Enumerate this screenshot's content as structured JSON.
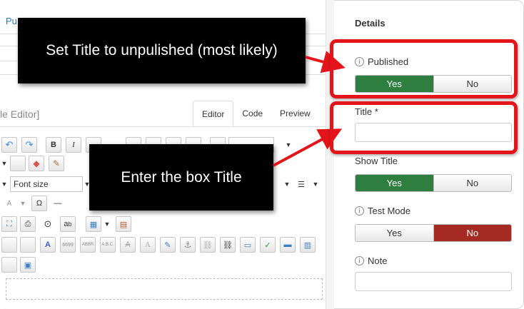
{
  "left": {
    "published_tab": "Pu",
    "editor_label": "le Editor]",
    "tabs": [
      {
        "label": "Editor",
        "active": true
      },
      {
        "label": "Code",
        "active": false
      },
      {
        "label": "Preview",
        "active": false
      }
    ],
    "toolbar": {
      "bold": "B",
      "italic": "I",
      "font_size": "Font size",
      "omega": "Ω",
      "abbr_a": "a",
      "abbr_b": "b",
      "quote": "6699",
      "abbr": "ABBR",
      "acronym": "A.B.C.",
      "strike_a": "A",
      "a_big": "A",
      "aa_small": "A"
    }
  },
  "annotations": {
    "callout_published": "Set Title to unpulished (most likely)",
    "callout_title": "Enter the box Title"
  },
  "details": {
    "heading": "Details",
    "published": {
      "label": "Published",
      "yes": "Yes",
      "no": "No",
      "selected": "yes"
    },
    "title": {
      "label": "Title *",
      "value": ""
    },
    "show_title": {
      "label": "Show Title",
      "yes": "Yes",
      "no": "No",
      "selected": "yes"
    },
    "test_mode": {
      "label": "Test Mode",
      "yes": "Yes",
      "no": "No",
      "selected": "no"
    },
    "note": {
      "label": "Note",
      "value": ""
    }
  },
  "colors": {
    "yes_active": "#2d7e3f",
    "no_active": "#a42a23",
    "highlight": "#e4141b"
  }
}
